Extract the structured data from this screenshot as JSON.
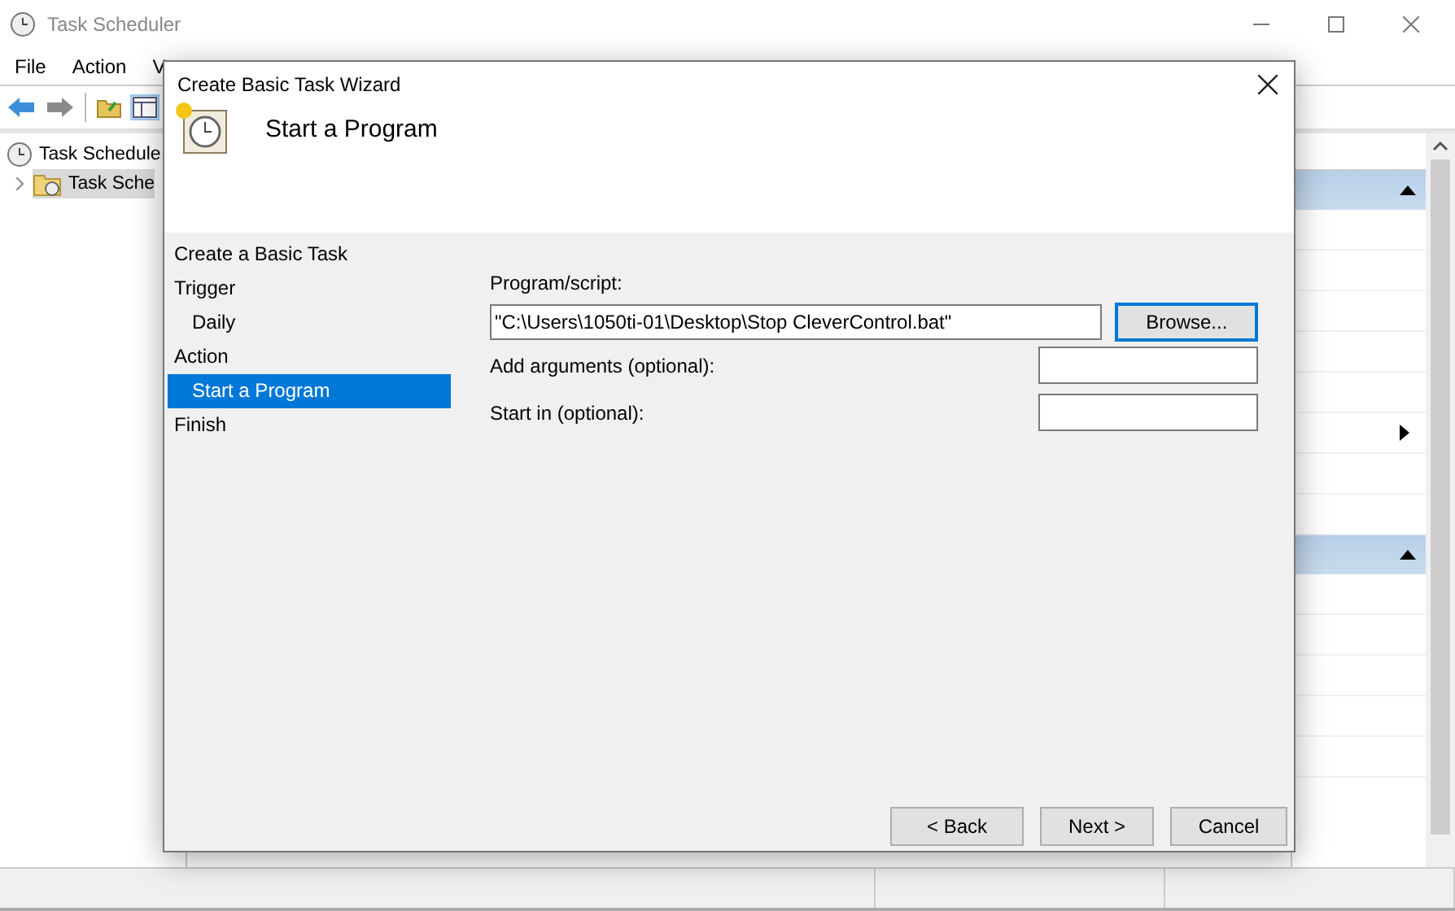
{
  "app": {
    "title": "Task Scheduler",
    "menu": [
      "File",
      "Action",
      "V"
    ],
    "tree": [
      {
        "label": "Task Schedule",
        "selected": false,
        "children": [
          {
            "label": "Task Sche",
            "selected": true,
            "expanded": false
          }
        ]
      }
    ],
    "actions_pane": {
      "sections": [
        {
          "expanded": true,
          "rows": [
            {
              "submenu": false
            },
            {
              "submenu": false
            },
            {
              "submenu": false
            },
            {
              "submenu": false
            },
            {
              "submenu": false
            },
            {
              "submenu": true
            },
            {
              "submenu": false
            },
            {
              "submenu": false
            }
          ]
        },
        {
          "expanded": true,
          "rows": [
            {
              "submenu": false
            },
            {
              "submenu": false
            },
            {
              "submenu": false
            },
            {
              "submenu": false
            },
            {
              "submenu": false
            }
          ]
        }
      ]
    }
  },
  "dialog": {
    "title": "Create Basic Task Wizard",
    "heading": "Start a Program",
    "steps": [
      {
        "label": "Create a Basic Task",
        "selected": false
      },
      {
        "label": "Trigger",
        "selected": false,
        "children": [
          {
            "label": "Daily",
            "selected": false
          }
        ]
      },
      {
        "label": "Action",
        "selected": false,
        "children": [
          {
            "label": "Start a Program",
            "selected": true
          }
        ]
      },
      {
        "label": "Finish",
        "selected": false
      }
    ],
    "program": {
      "label": "Program/script:",
      "value": "\"C:\\Users\\1050ti-01\\Desktop\\Stop CleverControl.bat\"",
      "browse": {
        "label": "Browse...",
        "focused": true
      }
    },
    "fields": [
      {
        "label": "Add arguments (optional):"
      },
      {
        "label": "Start in (optional):"
      }
    ],
    "buttons": [
      "< Back",
      "Next >",
      "Cancel"
    ]
  }
}
